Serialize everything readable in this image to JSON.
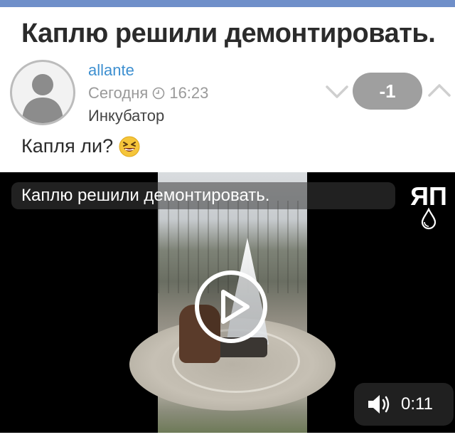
{
  "post": {
    "title": "Каплю решили демонтировать.",
    "author": "allante",
    "date_label": "Сегодня",
    "time": "16:23",
    "community": "Инкубатор",
    "rating": "-1",
    "text": "Капля ли?",
    "emoji": "laughing-emoji-icon"
  },
  "video": {
    "overlay_title": "Каплю решили демонтировать.",
    "logo_text": "ЯП",
    "duration": "0:11",
    "sound_icon": "speaker-icon",
    "play_icon": "play-icon"
  },
  "colors": {
    "header_bar": "#6f8fc9",
    "author_link": "#3d8fd0",
    "rating_badge": "#9f9f9f"
  }
}
